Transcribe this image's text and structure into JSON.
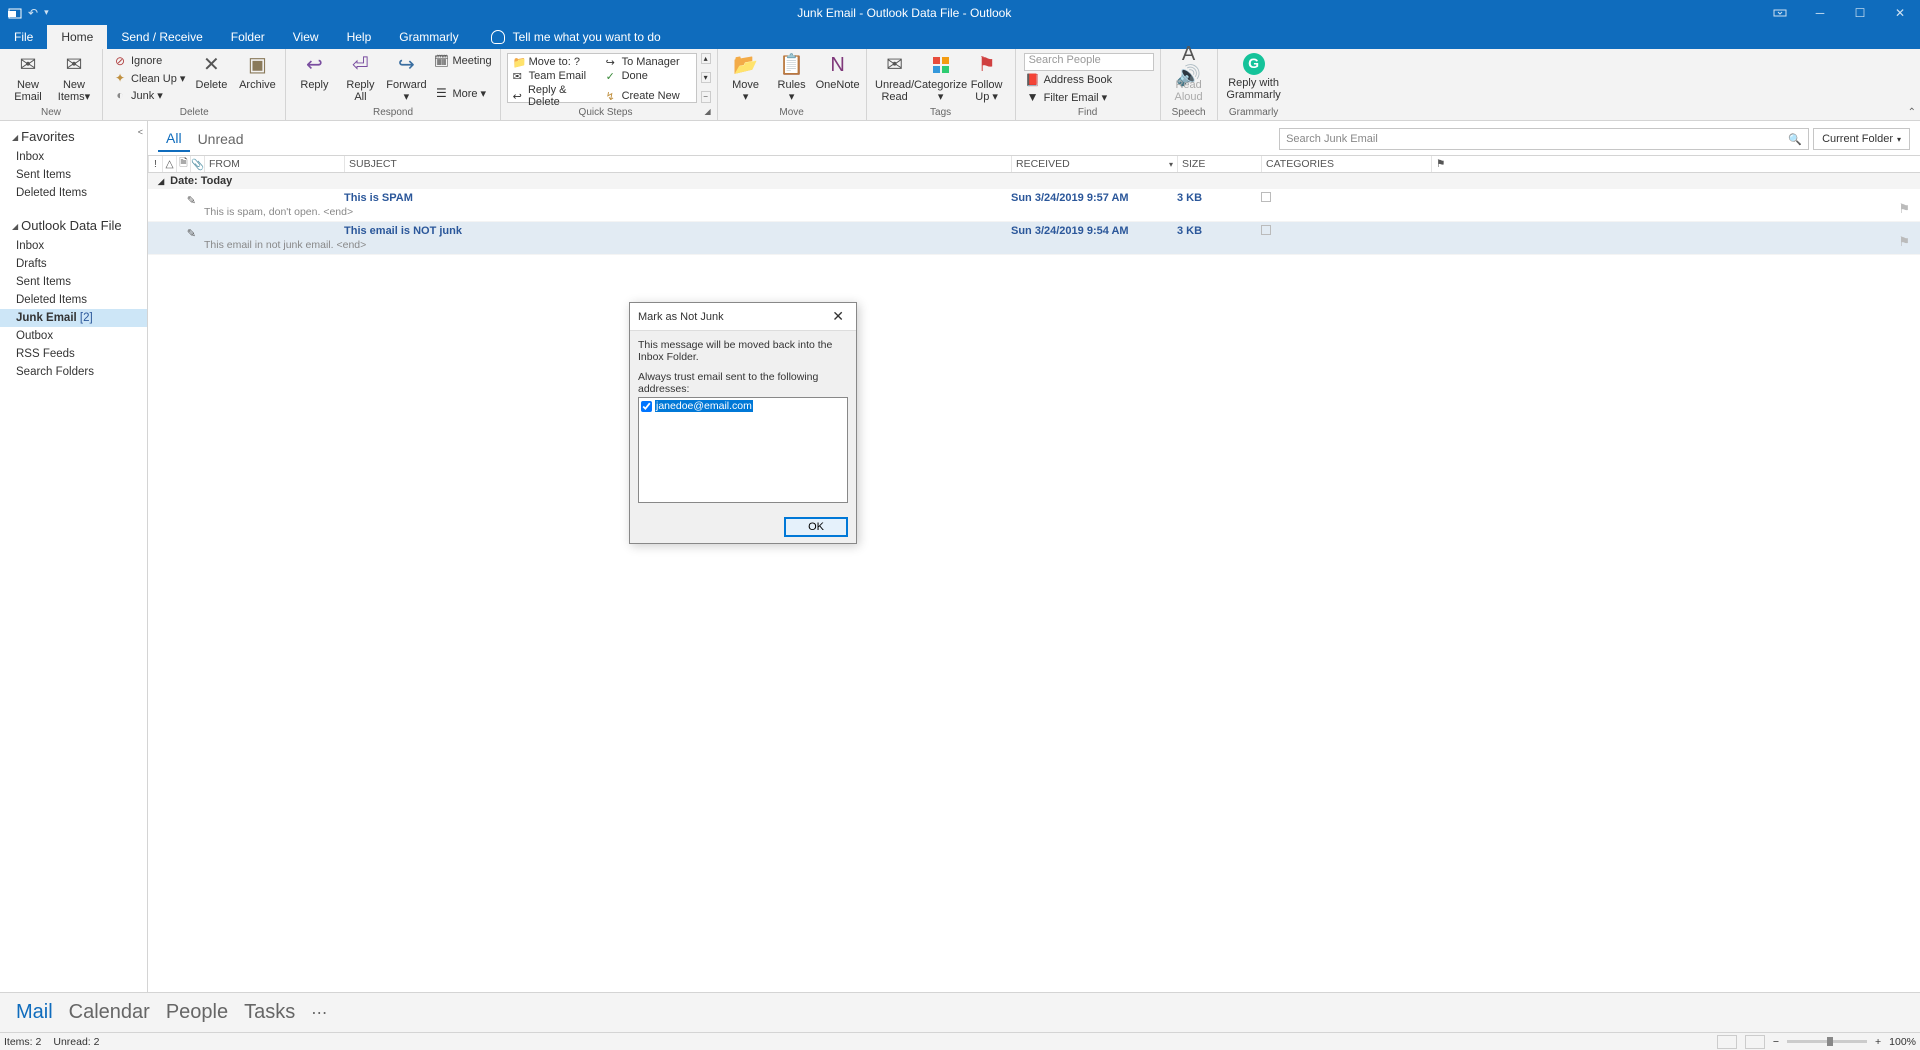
{
  "title_bar": {
    "title": "Junk Email - Outlook Data File  -  Outlook"
  },
  "menu": {
    "file": "File",
    "home": "Home",
    "send_receive": "Send / Receive",
    "folder": "Folder",
    "view": "View",
    "help": "Help",
    "grammarly": "Grammarly",
    "tell_me": "Tell me what you want to do"
  },
  "ribbon": {
    "new": {
      "new_email": "New\nEmail",
      "new_items": "New\nItems",
      "label": "New"
    },
    "delete": {
      "ignore": "Ignore",
      "cleanup": "Clean Up",
      "junk": "Junk",
      "delete": "Delete",
      "archive": "Archive",
      "label": "Delete"
    },
    "respond": {
      "reply": "Reply",
      "reply_all": "Reply\nAll",
      "forward": "Forward",
      "meeting": "Meeting",
      "more": "More",
      "label": "Respond"
    },
    "quick_steps": {
      "move_to": "Move to: ?",
      "to_manager": "To Manager",
      "team_email": "Team Email",
      "done": "Done",
      "reply_delete": "Reply & Delete",
      "create_new": "Create New",
      "label": "Quick Steps"
    },
    "move": {
      "move": "Move",
      "rules": "Rules",
      "onenote": "OneNote",
      "label": "Move"
    },
    "tags": {
      "unread": "Unread/\nRead",
      "categorize": "Categorize",
      "followup": "Follow\nUp",
      "label": "Tags"
    },
    "find": {
      "search_people_ph": "Search People",
      "address_book": "Address Book",
      "filter_email": "Filter Email",
      "label": "Find"
    },
    "speech": {
      "read_aloud": "Read\nAloud",
      "label": "Speech"
    },
    "grammarly": {
      "reply": "Reply with\nGrammarly",
      "label": "Grammarly"
    }
  },
  "nav": {
    "favorites": "Favorites",
    "fav_items": [
      "Inbox",
      "Sent Items",
      "Deleted Items"
    ],
    "data_file": "Outlook Data File",
    "df_items": [
      "Inbox",
      "Drafts",
      "Sent Items",
      "Deleted Items"
    ],
    "junk": "Junk Email",
    "junk_count": "[2]",
    "df_items2": [
      "Outbox",
      "RSS Feeds",
      "Search Folders"
    ]
  },
  "list": {
    "all": "All",
    "unread": "Unread",
    "search_ph": "Search Junk Email",
    "scope": "Current Folder",
    "cols": {
      "from": "FROM",
      "subject": "SUBJECT",
      "received": "RECEIVED",
      "size": "SIZE",
      "categories": "CATEGORIES"
    },
    "group0": "Date: Today",
    "messages": [
      {
        "subject": "This is SPAM",
        "preview": "This is spam, don't open. <end>",
        "received": "Sun 3/24/2019 9:57 AM",
        "size": "3 KB"
      },
      {
        "subject": "This email is NOT junk",
        "preview": "This email in not junk email. <end>",
        "received": "Sun 3/24/2019 9:54 AM",
        "size": "3 KB"
      }
    ]
  },
  "dialog": {
    "title": "Mark as Not Junk",
    "message": "This message will be moved back into the Inbox Folder.",
    "label": "Always trust email sent to the following addresses:",
    "email": "janedoe@email.com",
    "ok": "OK"
  },
  "bottom_nav": {
    "mail": "Mail",
    "calendar": "Calendar",
    "people": "People",
    "tasks": "Tasks"
  },
  "status": {
    "items": "Items: 2",
    "unread": "Unread: 2",
    "zoom": "100%"
  }
}
